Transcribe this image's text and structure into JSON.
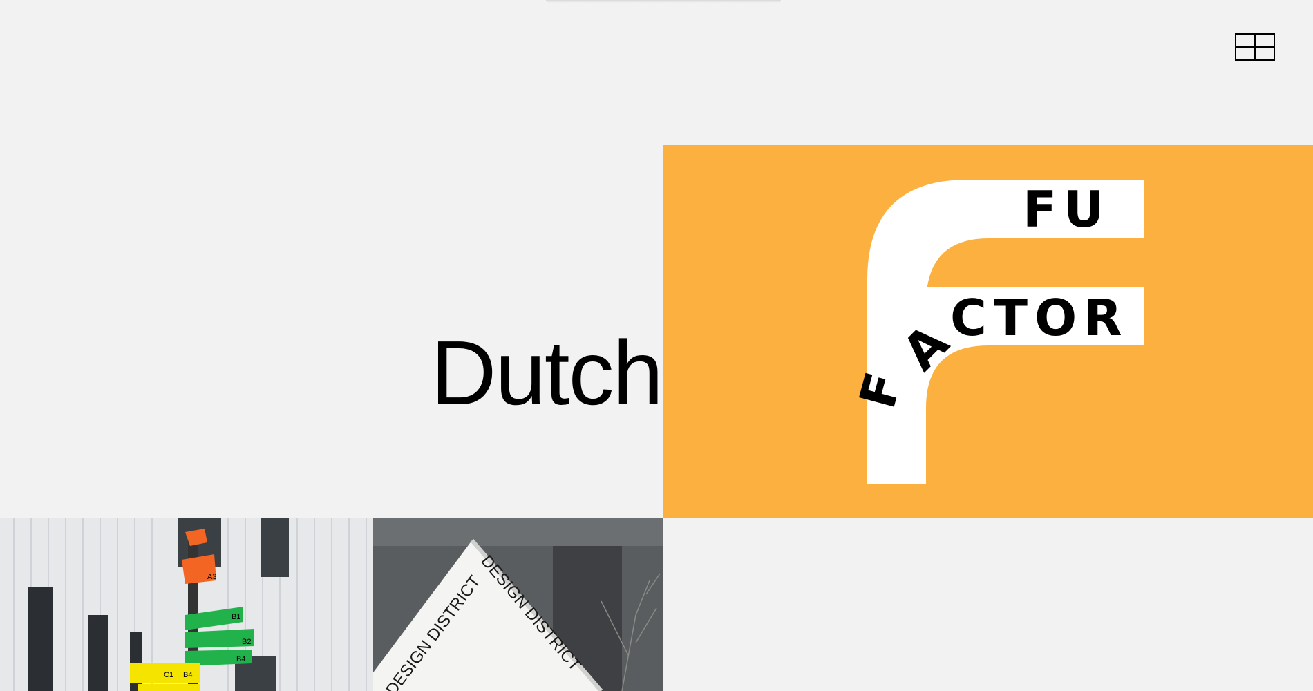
{
  "header": {
    "menu_icon": "grid-menu-icon"
  },
  "project": {
    "title": "Dutch"
  },
  "hero": {
    "background_color": "#fbb040",
    "logo_line1": "FU",
    "logo_line2": "CTOR",
    "logo_letter_a": "A",
    "logo_letter_f": "F"
  },
  "thumbnails": {
    "left_icon": "wayfinding-signpost-photo",
    "sign_labels": [
      "A3",
      "B1",
      "B2",
      "B4",
      "C1",
      "B4"
    ],
    "right_icon": "design-district-sign-photo",
    "right_text_a": "DESIGN DISTRICT",
    "right_text_b": "DESIGN DISTRICT"
  }
}
